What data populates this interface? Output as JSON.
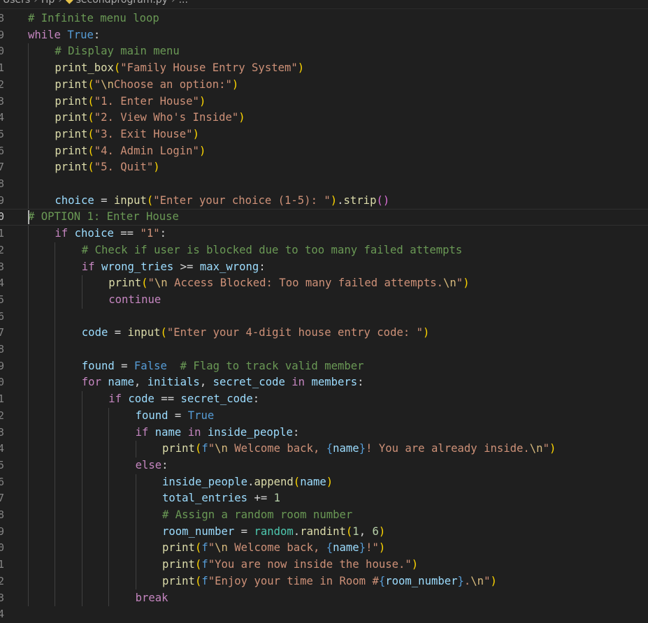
{
  "breadcrumb": {
    "parts": [
      "Users",
      "Hp",
      "secondprogram.py",
      "..."
    ]
  },
  "editor": {
    "current_line_index": 12,
    "lines": [
      {
        "n": "8",
        "indent": 0,
        "t": [
          [
            "cmt",
            "# Infinite menu loop"
          ]
        ]
      },
      {
        "n": "9",
        "indent": 0,
        "t": [
          [
            "ctl",
            "while"
          ],
          [
            "op",
            " "
          ],
          [
            "kw",
            "True"
          ],
          [
            "op",
            ":"
          ]
        ]
      },
      {
        "n": "0",
        "indent": 1,
        "t": [
          [
            "cmt",
            "# Display main menu"
          ]
        ]
      },
      {
        "n": "1",
        "indent": 1,
        "t": [
          [
            "fn",
            "print_box"
          ],
          [
            "p1",
            "("
          ],
          [
            "str",
            "\"Family House Entry System\""
          ],
          [
            "p1",
            ")"
          ]
        ]
      },
      {
        "n": "2",
        "indent": 1,
        "t": [
          [
            "fn",
            "print"
          ],
          [
            "p1",
            "("
          ],
          [
            "str",
            "\""
          ],
          [
            "esc",
            "\\n"
          ],
          [
            "str",
            "Choose an option:\""
          ],
          [
            "p1",
            ")"
          ]
        ]
      },
      {
        "n": "3",
        "indent": 1,
        "t": [
          [
            "fn",
            "print"
          ],
          [
            "p1",
            "("
          ],
          [
            "str",
            "\"1. Enter House\""
          ],
          [
            "p1",
            ")"
          ]
        ]
      },
      {
        "n": "4",
        "indent": 1,
        "t": [
          [
            "fn",
            "print"
          ],
          [
            "p1",
            "("
          ],
          [
            "str",
            "\"2. View Who's Inside\""
          ],
          [
            "p1",
            ")"
          ]
        ]
      },
      {
        "n": "5",
        "indent": 1,
        "t": [
          [
            "fn",
            "print"
          ],
          [
            "p1",
            "("
          ],
          [
            "str",
            "\"3. Exit House\""
          ],
          [
            "p1",
            ")"
          ]
        ]
      },
      {
        "n": "6",
        "indent": 1,
        "t": [
          [
            "fn",
            "print"
          ],
          [
            "p1",
            "("
          ],
          [
            "str",
            "\"4. Admin Login\""
          ],
          [
            "p1",
            ")"
          ]
        ]
      },
      {
        "n": "7",
        "indent": 1,
        "t": [
          [
            "fn",
            "print"
          ],
          [
            "p1",
            "("
          ],
          [
            "str",
            "\"5. Quit\""
          ],
          [
            "p1",
            ")"
          ]
        ]
      },
      {
        "n": "8",
        "indent": 0,
        "t": []
      },
      {
        "n": "9",
        "indent": 1,
        "t": [
          [
            "var",
            "choice"
          ],
          [
            "op",
            " = "
          ],
          [
            "fn",
            "input"
          ],
          [
            "p1",
            "("
          ],
          [
            "str",
            "\"Enter your choice (1-5): \""
          ],
          [
            "p1",
            ")"
          ],
          [
            "op",
            "."
          ],
          [
            "fn",
            "strip"
          ],
          [
            "p2",
            "("
          ],
          [
            "p2",
            ")"
          ]
        ]
      },
      {
        "n": "0",
        "indent": 0,
        "t": [
          [
            "cmt",
            "# OPTION 1: Enter House"
          ]
        ]
      },
      {
        "n": "1",
        "indent": 1,
        "t": [
          [
            "ctl",
            "if"
          ],
          [
            "op",
            " "
          ],
          [
            "var",
            "choice"
          ],
          [
            "op",
            " == "
          ],
          [
            "str",
            "\"1\""
          ],
          [
            "op",
            ":"
          ]
        ]
      },
      {
        "n": "2",
        "indent": 2,
        "t": [
          [
            "cmt",
            "# Check if user is blocked due to too many failed attempts"
          ]
        ]
      },
      {
        "n": "3",
        "indent": 2,
        "t": [
          [
            "ctl",
            "if"
          ],
          [
            "op",
            " "
          ],
          [
            "var",
            "wrong_tries"
          ],
          [
            "op",
            " >= "
          ],
          [
            "var",
            "max_wrong"
          ],
          [
            "op",
            ":"
          ]
        ]
      },
      {
        "n": "4",
        "indent": 3,
        "t": [
          [
            "fn",
            "print"
          ],
          [
            "p1",
            "("
          ],
          [
            "str",
            "\""
          ],
          [
            "esc",
            "\\n"
          ],
          [
            "str",
            " Access Blocked: Too many failed attempts."
          ],
          [
            "esc",
            "\\n"
          ],
          [
            "str",
            "\""
          ],
          [
            "p1",
            ")"
          ]
        ]
      },
      {
        "n": "5",
        "indent": 3,
        "t": [
          [
            "ctl",
            "continue"
          ]
        ]
      },
      {
        "n": "6",
        "indent": 0,
        "t": []
      },
      {
        "n": "7",
        "indent": 2,
        "t": [
          [
            "var",
            "code"
          ],
          [
            "op",
            " = "
          ],
          [
            "fn",
            "input"
          ],
          [
            "p1",
            "("
          ],
          [
            "str",
            "\"Enter your 4-digit house entry code: \""
          ],
          [
            "p1",
            ")"
          ]
        ]
      },
      {
        "n": "8",
        "indent": 0,
        "t": []
      },
      {
        "n": "9",
        "indent": 2,
        "t": [
          [
            "var",
            "found"
          ],
          [
            "op",
            " = "
          ],
          [
            "kw",
            "False"
          ],
          [
            "op",
            "  "
          ],
          [
            "cmt",
            "# Flag to track valid member"
          ]
        ]
      },
      {
        "n": "0",
        "indent": 2,
        "t": [
          [
            "ctl",
            "for"
          ],
          [
            "op",
            " "
          ],
          [
            "var",
            "name"
          ],
          [
            "op",
            ", "
          ],
          [
            "var",
            "initials"
          ],
          [
            "op",
            ", "
          ],
          [
            "var",
            "secret_code"
          ],
          [
            "op",
            " "
          ],
          [
            "ctl",
            "in"
          ],
          [
            "op",
            " "
          ],
          [
            "var",
            "members"
          ],
          [
            "op",
            ":"
          ]
        ]
      },
      {
        "n": "1",
        "indent": 3,
        "t": [
          [
            "ctl",
            "if"
          ],
          [
            "op",
            " "
          ],
          [
            "var",
            "code"
          ],
          [
            "op",
            " == "
          ],
          [
            "var",
            "secret_code"
          ],
          [
            "op",
            ":"
          ]
        ]
      },
      {
        "n": "2",
        "indent": 4,
        "t": [
          [
            "var",
            "found"
          ],
          [
            "op",
            " = "
          ],
          [
            "kw",
            "True"
          ]
        ]
      },
      {
        "n": "3",
        "indent": 4,
        "t": [
          [
            "ctl",
            "if"
          ],
          [
            "op",
            " "
          ],
          [
            "var",
            "name"
          ],
          [
            "op",
            " "
          ],
          [
            "ctl",
            "in"
          ],
          [
            "op",
            " "
          ],
          [
            "var",
            "inside_people"
          ],
          [
            "op",
            ":"
          ]
        ]
      },
      {
        "n": "4",
        "indent": 5,
        "t": [
          [
            "fn",
            "print"
          ],
          [
            "p1",
            "("
          ],
          [
            "kw",
            "f"
          ],
          [
            "str",
            "\""
          ],
          [
            "esc",
            "\\n"
          ],
          [
            "str",
            " Welcome back, "
          ],
          [
            "kw",
            "{"
          ],
          [
            "var",
            "name"
          ],
          [
            "kw",
            "}"
          ],
          [
            "str",
            "! You are already inside."
          ],
          [
            "esc",
            "\\n"
          ],
          [
            "str",
            "\""
          ],
          [
            "p1",
            ")"
          ]
        ]
      },
      {
        "n": "5",
        "indent": 4,
        "t": [
          [
            "ctl",
            "else"
          ],
          [
            "op",
            ":"
          ]
        ]
      },
      {
        "n": "6",
        "indent": 5,
        "t": [
          [
            "var",
            "inside_people"
          ],
          [
            "op",
            "."
          ],
          [
            "fn",
            "append"
          ],
          [
            "p1",
            "("
          ],
          [
            "var",
            "name"
          ],
          [
            "p1",
            ")"
          ]
        ]
      },
      {
        "n": "7",
        "indent": 5,
        "t": [
          [
            "var",
            "total_entries"
          ],
          [
            "op",
            " += "
          ],
          [
            "num",
            "1"
          ]
        ]
      },
      {
        "n": "8",
        "indent": 5,
        "t": [
          [
            "cmt",
            "# Assign a random room number"
          ]
        ]
      },
      {
        "n": "9",
        "indent": 5,
        "t": [
          [
            "var",
            "room_number"
          ],
          [
            "op",
            " = "
          ],
          [
            "cls",
            "random"
          ],
          [
            "op",
            "."
          ],
          [
            "fn",
            "randint"
          ],
          [
            "p1",
            "("
          ],
          [
            "num",
            "1"
          ],
          [
            "op",
            ", "
          ],
          [
            "num",
            "6"
          ],
          [
            "p1",
            ")"
          ]
        ]
      },
      {
        "n": "0",
        "indent": 5,
        "t": [
          [
            "fn",
            "print"
          ],
          [
            "p1",
            "("
          ],
          [
            "kw",
            "f"
          ],
          [
            "str",
            "\""
          ],
          [
            "esc",
            "\\n"
          ],
          [
            "str",
            " Welcome back, "
          ],
          [
            "kw",
            "{"
          ],
          [
            "var",
            "name"
          ],
          [
            "kw",
            "}"
          ],
          [
            "str",
            "!\""
          ],
          [
            "p1",
            ")"
          ]
        ]
      },
      {
        "n": "1",
        "indent": 5,
        "t": [
          [
            "fn",
            "print"
          ],
          [
            "p1",
            "("
          ],
          [
            "kw",
            "f"
          ],
          [
            "str",
            "\"You are now inside the house.\""
          ],
          [
            "p1",
            ")"
          ]
        ]
      },
      {
        "n": "2",
        "indent": 5,
        "t": [
          [
            "fn",
            "print"
          ],
          [
            "p1",
            "("
          ],
          [
            "kw",
            "f"
          ],
          [
            "str",
            "\"Enjoy your time in Room #"
          ],
          [
            "kw",
            "{"
          ],
          [
            "var",
            "room_number"
          ],
          [
            "kw",
            "}"
          ],
          [
            "str",
            "."
          ],
          [
            "esc",
            "\\n"
          ],
          [
            "str",
            "\""
          ],
          [
            "p1",
            ")"
          ]
        ]
      },
      {
        "n": "3",
        "indent": 4,
        "t": [
          [
            "ctl",
            "break"
          ]
        ]
      },
      {
        "n": "4",
        "indent": 0,
        "t": []
      }
    ]
  }
}
